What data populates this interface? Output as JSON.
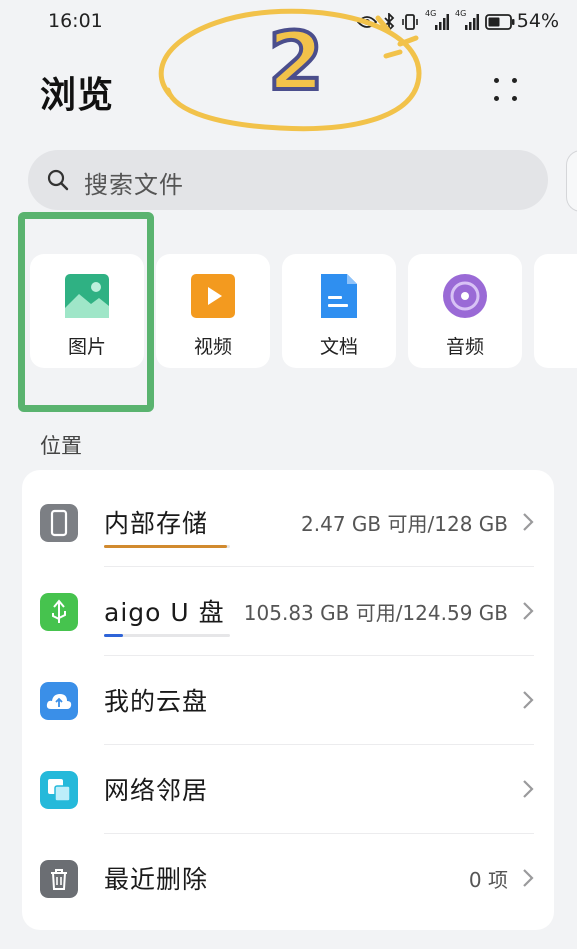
{
  "status_bar": {
    "time": "16:01",
    "battery_percent": "54%",
    "network_label_1": "4G",
    "network_label_2": "4G"
  },
  "header": {
    "title": "浏览",
    "annotation_step": "2"
  },
  "search": {
    "placeholder": "搜索文件"
  },
  "categories": [
    {
      "label": "图片",
      "icon": "image-icon",
      "color": "#35b58c"
    },
    {
      "label": "视频",
      "icon": "video-icon",
      "color": "#f39a1f"
    },
    {
      "label": "文档",
      "icon": "document-icon",
      "color": "#2f8ff0"
    },
    {
      "label": "音频",
      "icon": "audio-icon",
      "color": "#9a6ad6"
    }
  ],
  "highlighted_category": "图片",
  "location_section": {
    "title": "位置",
    "items": [
      {
        "label": "内部存储",
        "detail": "2.47 GB 可用/128 GB",
        "icon": "phone-icon",
        "icon_color": "#7c7f84",
        "usage_fraction": 0.98,
        "bar_color": "#d18a2f"
      },
      {
        "label": "aigo U 盘",
        "detail": "105.83 GB 可用/124.59 GB",
        "icon": "usb-icon",
        "icon_color": "#46c34e",
        "usage_fraction": 0.15,
        "bar_color": "#2e64d8"
      },
      {
        "label": "我的云盘",
        "detail": "",
        "icon": "cloud-icon",
        "icon_color": "#3a8fe8"
      },
      {
        "label": "网络邻居",
        "detail": "",
        "icon": "network-icon",
        "icon_color": "#25b9da"
      },
      {
        "label": "最近删除",
        "detail": "0 项",
        "icon": "trash-icon",
        "icon_color": "#6b6e73"
      }
    ]
  },
  "colors": {
    "background": "#f2f3f5",
    "highlight": "#5ab36f",
    "annotation": "#f2c24a"
  }
}
